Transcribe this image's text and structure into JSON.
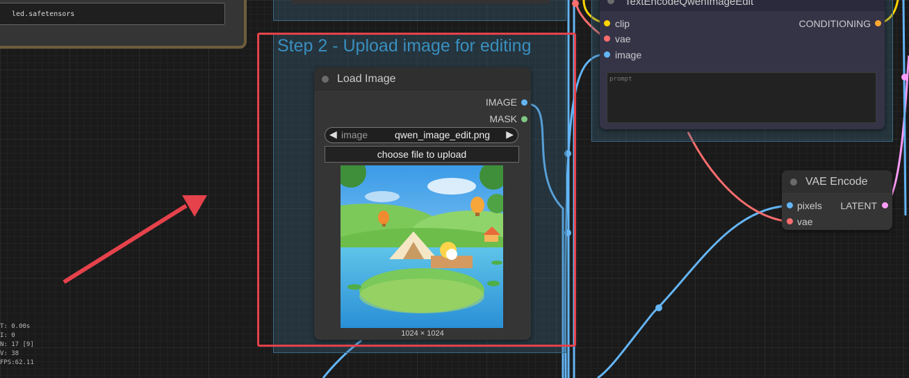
{
  "checkpoint_node": {
    "filename": "led.safetensors"
  },
  "group": {
    "title": "Step 2 - Upload image for editing"
  },
  "load_image": {
    "title": "Load Image",
    "outputs": [
      "IMAGE",
      "MASK"
    ],
    "combo_label": "image",
    "combo_value": "qwen_image_edit.png",
    "upload_label": "choose file to upload",
    "image_size": "1024 × 1024"
  },
  "text_encode": {
    "title": "TextEncodeQwenImageEdit",
    "inputs": [
      "clip",
      "vae",
      "image"
    ],
    "output": "CONDITIONING",
    "prompt_placeholder": "prompt"
  },
  "vae_encode": {
    "title": "VAE Encode",
    "inputs": [
      "pixels",
      "vae"
    ],
    "output": "LATENT"
  },
  "stats": [
    "T: 0.00s",
    "I: 0",
    "N: 17 [9]",
    "V: 38",
    "FPS:62.11"
  ],
  "colors": {
    "image_slot": "#64b5f6",
    "mask_slot": "#81c784",
    "clip_slot": "#ffd500",
    "vae_slot": "#ff6e6e",
    "conditioning_slot": "#ffa931",
    "latent_slot": "#ff9cf9",
    "highlight": "#e5424b",
    "arrow": "#e5424b"
  }
}
